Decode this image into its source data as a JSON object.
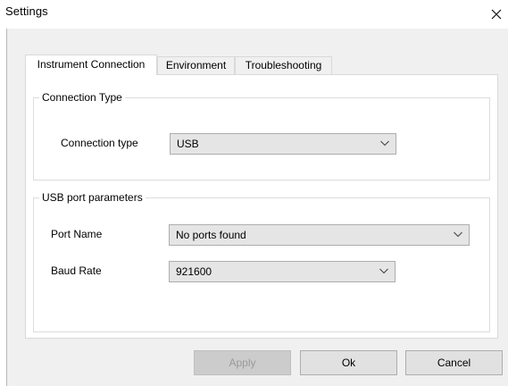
{
  "window": {
    "title": "Settings",
    "close_glyph": "✕"
  },
  "tabs": [
    {
      "label": "Instrument Connection",
      "active": true
    },
    {
      "label": "Environment",
      "active": false
    },
    {
      "label": "Troubleshooting",
      "active": false
    }
  ],
  "connection_group": {
    "title": "Connection Type",
    "connection_type_label": "Connection type",
    "connection_type_value": "USB"
  },
  "usb_group": {
    "title": "USB port parameters",
    "port_name_label": "Port Name",
    "port_name_value": "No ports found",
    "baud_rate_label": "Baud Rate",
    "baud_rate_value": "921600"
  },
  "buttons": {
    "apply": {
      "label": "Apply",
      "enabled": false
    },
    "ok": {
      "label": "Ok"
    },
    "cancel": {
      "label": "Cancel"
    }
  },
  "icons": {
    "close": "close-icon",
    "dropdown": "chevron-down-icon"
  }
}
